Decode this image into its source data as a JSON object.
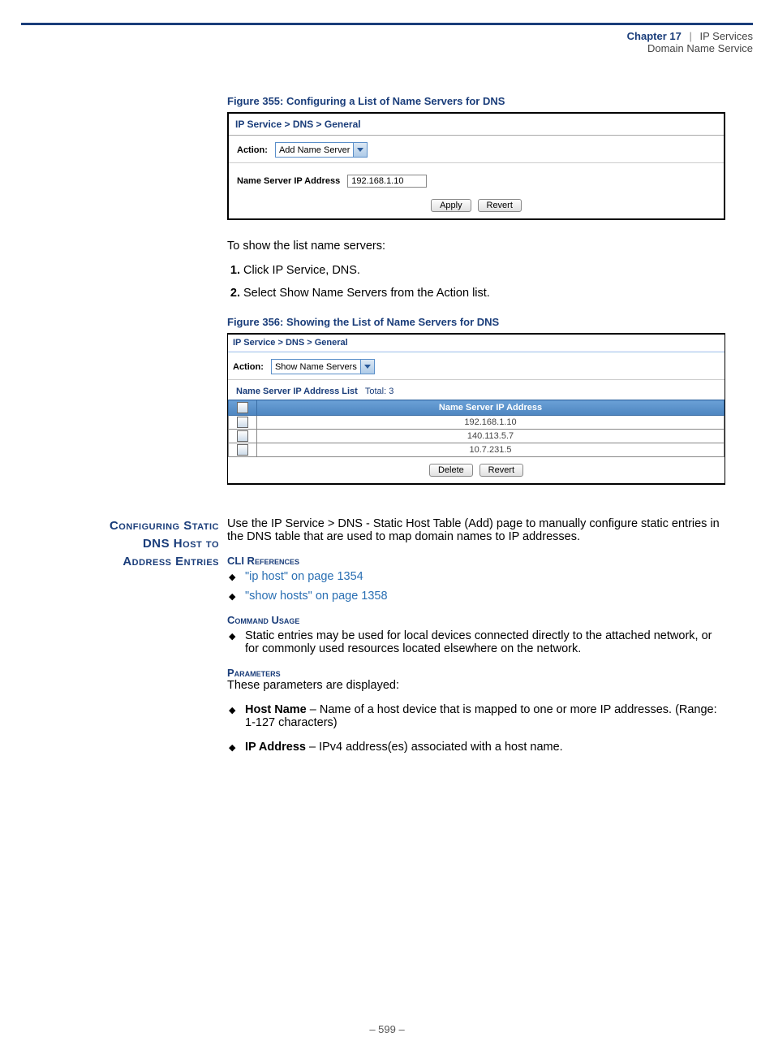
{
  "header": {
    "chapter": "Chapter 17",
    "sep": "|",
    "subj": "IP Services",
    "line2": "Domain Name Service"
  },
  "fig355": {
    "caption": "Figure 355:  Configuring a List of Name Servers for DNS",
    "crumb1": "IP Service",
    "crumb2": "DNS",
    "crumb3": "General",
    "action_label": "Action:",
    "action_value": "Add Name Server",
    "ip_label": "Name Server IP Address",
    "ip_value": "192.168.1.10",
    "btn_apply": "Apply",
    "btn_revert": "Revert"
  },
  "intro_text": "To show the list name servers:",
  "steps": [
    "Click IP Service, DNS.",
    "Select Show Name Servers from the Action list."
  ],
  "fig356": {
    "caption": "Figure 356:  Showing the List of Name Servers for DNS",
    "crumb1": "IP Service",
    "crumb2": "DNS",
    "crumb3": "General",
    "action_label": "Action:",
    "action_value": "Show Name Servers",
    "list_title": "Name Server IP Address List",
    "total_lbl": "Total: 3",
    "col_header": "Name Server IP Address",
    "rows": [
      "192.168.1.10",
      "140.113.5.7",
      "10.7.231.5"
    ],
    "btn_delete": "Delete",
    "btn_revert": "Revert"
  },
  "side_heading": {
    "l1": "Configuring Static",
    "l2": "DNS Host to",
    "l3": "Address Entries"
  },
  "main_intro": "Use the IP Service > DNS - Static Host Table (Add) page to manually configure static entries in the DNS table that are used to map domain names to IP addresses.",
  "cli_ref_head": "CLI References",
  "cli_refs": [
    "\"ip host\" on page 1354",
    "\"show hosts\" on page 1358"
  ],
  "cmd_use_head": "Command Usage",
  "cmd_use_item": "Static entries may be used for local devices connected directly to the attached network, or for commonly used resources located elsewhere on the network.",
  "param_head": "Parameters",
  "param_intro": "These parameters are displayed:",
  "params": [
    {
      "name": "Host Name",
      "desc": " – Name of a host device that is mapped to one or more IP addresses. (Range: 1-127 characters)"
    },
    {
      "name": "IP Address",
      "desc": " – IPv4 address(es) associated with a host name."
    }
  ],
  "page_number": "–  599  –"
}
